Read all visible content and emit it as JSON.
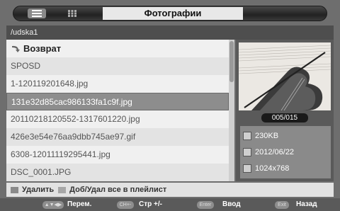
{
  "header": {
    "title": "Фотографии"
  },
  "path": "/udska1",
  "files": {
    "back_label": "Возврат",
    "items": [
      "SPOSD",
      "1-120119201648.jpg",
      "131e32d85cac986133fa1c9f.jpg",
      "20110218120552-1317601220.jpg",
      "426e3e54e76aa9dbb745ae97.gif",
      "6308-12011119295441.jpg",
      "DSC_0001.JPG"
    ]
  },
  "preview": {
    "counter": "005/015",
    "size": "230KB",
    "date": "2012/06/22",
    "resolution": "1024x768"
  },
  "legend": {
    "delete_label": "Удалить",
    "playlist_label": "Доб/Удал все в плейлист"
  },
  "hints": {
    "move_key": "▲▼◀▶",
    "move_label": "Перем.",
    "page_key": "CH+-",
    "page_label": "Стр +/-",
    "enter_key": "Enter",
    "enter_label": "Ввод",
    "exit_key": "Exit",
    "exit_label": "Назад"
  },
  "colors": {
    "selected_row": "#8d8d8d",
    "background": "#6e6e6e"
  },
  "icons": [
    "list-view-icon",
    "grid-view-icon",
    "back-arrow-icon",
    "size-icon",
    "date-icon",
    "resolution-icon"
  ]
}
